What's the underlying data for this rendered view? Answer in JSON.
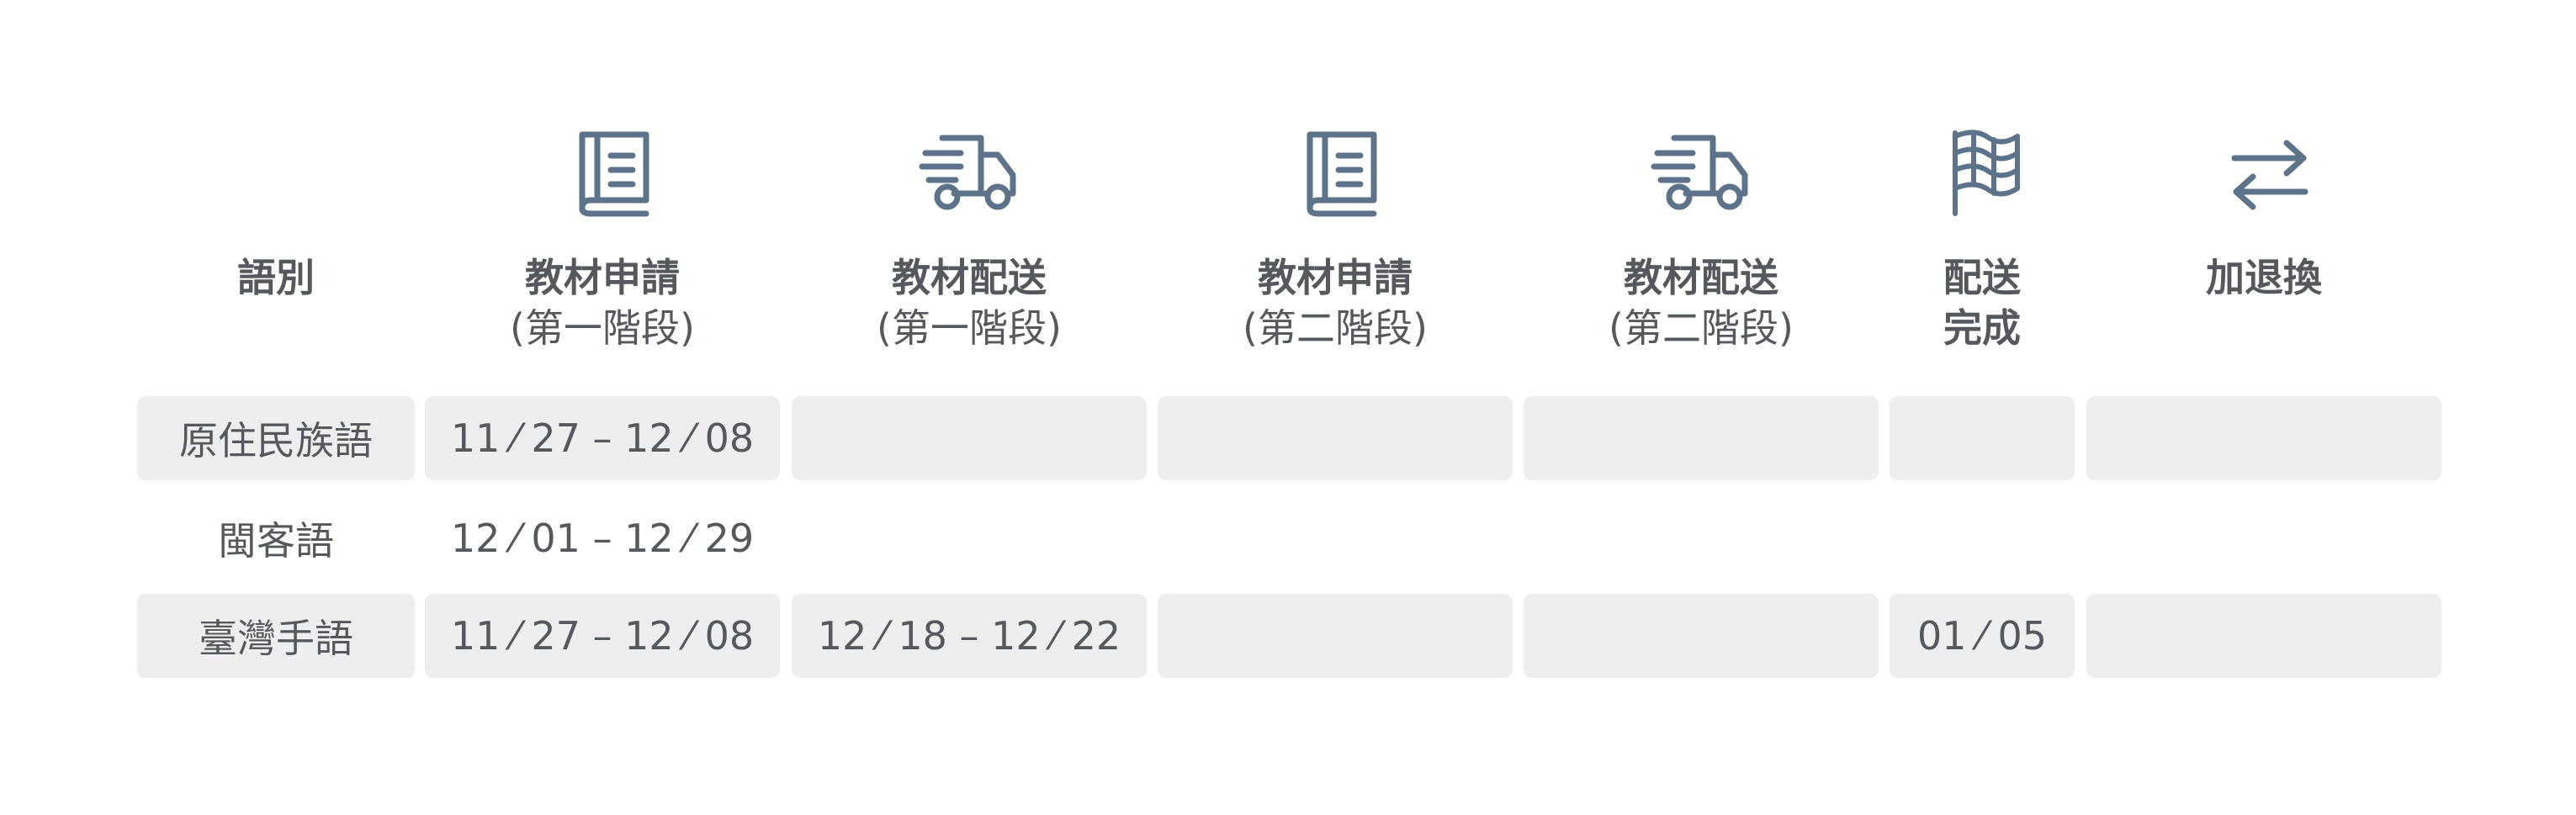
{
  "theme": {
    "icon_color": "#5d7389",
    "text_color": "#55595e",
    "row_fill": "#eeeeee"
  },
  "header": {
    "language": "語別",
    "columns": [
      {
        "title": "教材申請",
        "sub": "(第一階段)",
        "icon": "book-icon"
      },
      {
        "title": "教材配送",
        "sub": "(第一階段)",
        "icon": "delivery-truck-icon"
      },
      {
        "title": "教材申請",
        "sub": "(第二階段)",
        "icon": "book-icon"
      },
      {
        "title": "教材配送",
        "sub": "(第二階段)",
        "icon": "delivery-truck-icon"
      },
      {
        "title": "配送",
        "sub": "完成",
        "icon": "flag-icon"
      },
      {
        "title": "加退換",
        "sub": "",
        "icon": "exchange-arrows-icon"
      }
    ]
  },
  "rows": [
    {
      "language": "原住民族語",
      "cells": [
        "11 ⁄ 27 – 12 ⁄ 08",
        "",
        "",
        "",
        "",
        ""
      ]
    },
    {
      "language": "閩客語",
      "cells": [
        "12 ⁄ 01 – 12 ⁄ 29",
        "",
        "",
        "",
        "",
        ""
      ]
    },
    {
      "language": "臺灣手語",
      "cells": [
        "11 ⁄ 27 – 12 ⁄ 08",
        "12 ⁄ 18 – 12 ⁄ 22",
        "",
        "",
        "01 ⁄ 05",
        ""
      ]
    }
  ]
}
